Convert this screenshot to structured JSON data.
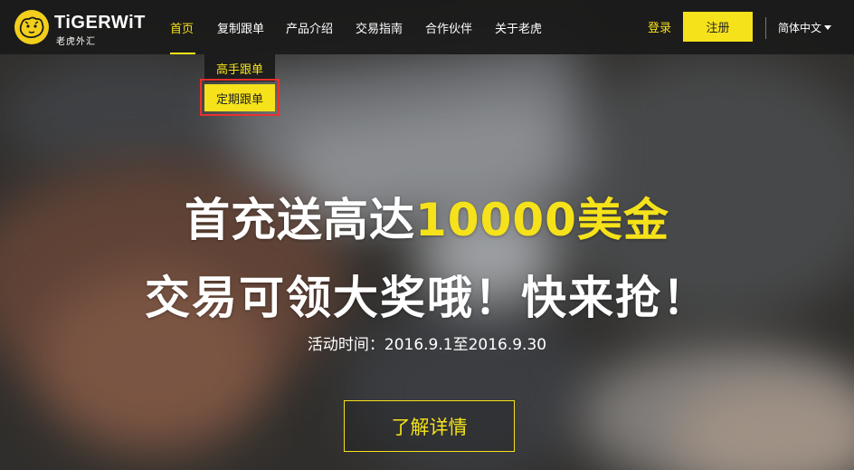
{
  "brand": {
    "logo_text": "TiGERWiT",
    "logo_subtext": "老虎外汇",
    "accent_color": "#f5e21a"
  },
  "nav": {
    "items": [
      {
        "label": "首页",
        "active": true
      },
      {
        "label": "复制跟单"
      },
      {
        "label": "产品介绍"
      },
      {
        "label": "交易指南"
      },
      {
        "label": "合作伙伴"
      },
      {
        "label": "关于老虎"
      }
    ],
    "dropdown": [
      {
        "label": "高手跟单"
      },
      {
        "label": "定期跟单",
        "highlighted": true
      }
    ]
  },
  "header_right": {
    "login_label": "登录",
    "register_label": "注册",
    "language_label": "简体中文",
    "language_icon": "caret-down-icon"
  },
  "hero": {
    "headline_part1": "首充送高达",
    "headline_highlight": "10000美金",
    "headline_line2": "交易可领大奖哦！快来抢！",
    "period_text": "活动时间：2016.9.1至2016.9.30",
    "cta_label": "了解详情"
  }
}
